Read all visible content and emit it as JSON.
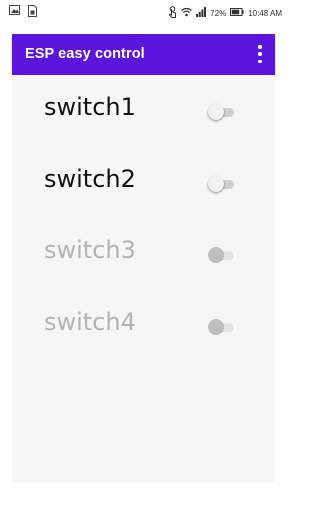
{
  "status_bar": {
    "battery": "72%",
    "time": "10:48 AM",
    "left_icons": [
      "image-icon",
      "sim-card-icon"
    ],
    "right_icons": [
      "touch-icon",
      "wifi-icon",
      "signal-icon"
    ]
  },
  "app_bar": {
    "title": "ESP easy control",
    "menu_icon": "overflow-menu-icon",
    "color": "#5c15dc"
  },
  "switches": [
    {
      "label": "switch1",
      "on": false,
      "enabled": true
    },
    {
      "label": "switch2",
      "on": false,
      "enabled": true
    },
    {
      "label": "switch3",
      "on": false,
      "enabled": false
    },
    {
      "label": "switch4",
      "on": false,
      "enabled": false
    }
  ]
}
